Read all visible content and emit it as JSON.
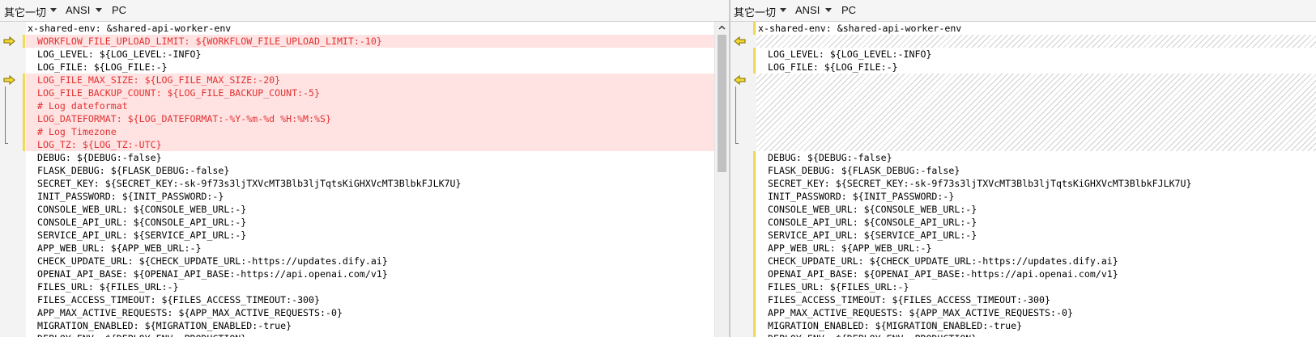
{
  "colors": {
    "changed_text": "#e23232",
    "changed_bg": "#ffe3e3",
    "change_bar": "#f1da55",
    "arrow_fill": "#f6d836"
  },
  "left": {
    "toolbar": {
      "encoding": "其它一切",
      "charset": "ANSI",
      "line_endings": "PC"
    },
    "lines": [
      {
        "text": "x-shared-env: &shared-api-worker-env",
        "state": "header"
      },
      {
        "text": "WORKFLOW_FILE_UPLOAD_LIMIT: ${WORKFLOW_FILE_UPLOAD_LIMIT:-10}",
        "state": "changed"
      },
      {
        "text": "LOG_LEVEL: ${LOG_LEVEL:-INFO}",
        "state": "normal"
      },
      {
        "text": "LOG_FILE: ${LOG_FILE:-}",
        "state": "normal"
      },
      {
        "text": "LOG_FILE_MAX_SIZE: ${LOG_FILE_MAX_SIZE:-20}",
        "state": "changed"
      },
      {
        "text": "LOG_FILE_BACKUP_COUNT: ${LOG_FILE_BACKUP_COUNT:-5}",
        "state": "changed"
      },
      {
        "text": "# Log dateformat",
        "state": "changed"
      },
      {
        "text": "LOG_DATEFORMAT: ${LOG_DATEFORMAT:-%Y-%m-%d %H:%M:%S}",
        "state": "changed"
      },
      {
        "text": "# Log Timezone",
        "state": "changed"
      },
      {
        "text": "LOG_TZ: ${LOG_TZ:-UTC}",
        "state": "changed"
      },
      {
        "text": "DEBUG: ${DEBUG:-false}",
        "state": "normal"
      },
      {
        "text": "FLASK_DEBUG: ${FLASK_DEBUG:-false}",
        "state": "normal"
      },
      {
        "text": "SECRET_KEY: ${SECRET_KEY:-sk-9f73s3ljTXVcMT3Blb3ljTqtsKiGHXVcMT3BlbkFJLK7U}",
        "state": "normal"
      },
      {
        "text": "INIT_PASSWORD: ${INIT_PASSWORD:-}",
        "state": "normal"
      },
      {
        "text": "CONSOLE_WEB_URL: ${CONSOLE_WEB_URL:-}",
        "state": "normal"
      },
      {
        "text": "CONSOLE_API_URL: ${CONSOLE_API_URL:-}",
        "state": "normal"
      },
      {
        "text": "SERVICE_API_URL: ${SERVICE_API_URL:-}",
        "state": "normal"
      },
      {
        "text": "APP_WEB_URL: ${APP_WEB_URL:-}",
        "state": "normal"
      },
      {
        "text": "CHECK_UPDATE_URL: ${CHECK_UPDATE_URL:-https://updates.dify.ai}",
        "state": "normal"
      },
      {
        "text": "OPENAI_API_BASE: ${OPENAI_API_BASE:-https://api.openai.com/v1}",
        "state": "normal"
      },
      {
        "text": "FILES_URL: ${FILES_URL:-}",
        "state": "normal"
      },
      {
        "text": "FILES_ACCESS_TIMEOUT: ${FILES_ACCESS_TIMEOUT:-300}",
        "state": "normal"
      },
      {
        "text": "APP_MAX_ACTIVE_REQUESTS: ${APP_MAX_ACTIVE_REQUESTS:-0}",
        "state": "normal"
      },
      {
        "text": "MIGRATION_ENABLED: ${MIGRATION_ENABLED:-true}",
        "state": "normal"
      },
      {
        "text": "DEPLOY_ENV: ${DEPLOY_ENV:-PRODUCTION}",
        "state": "normal"
      }
    ]
  },
  "right": {
    "toolbar": {
      "encoding": "其它一切",
      "charset": "ANSI",
      "line_endings": "PC"
    },
    "lines": [
      {
        "text": "x-shared-env: &shared-api-worker-env",
        "state": "header"
      },
      {
        "text": "",
        "state": "gap"
      },
      {
        "text": "LOG_LEVEL: ${LOG_LEVEL:-INFO}",
        "state": "normal"
      },
      {
        "text": "LOG_FILE: ${LOG_FILE:-}",
        "state": "normal"
      },
      {
        "text": "",
        "state": "gap"
      },
      {
        "text": "",
        "state": "gap"
      },
      {
        "text": "",
        "state": "gap"
      },
      {
        "text": "",
        "state": "gap"
      },
      {
        "text": "",
        "state": "gap"
      },
      {
        "text": "",
        "state": "gap"
      },
      {
        "text": "DEBUG: ${DEBUG:-false}",
        "state": "normal"
      },
      {
        "text": "FLASK_DEBUG: ${FLASK_DEBUG:-false}",
        "state": "normal"
      },
      {
        "text": "SECRET_KEY: ${SECRET_KEY:-sk-9f73s3ljTXVcMT3Blb3ljTqtsKiGHXVcMT3BlbkFJLK7U}",
        "state": "normal"
      },
      {
        "text": "INIT_PASSWORD: ${INIT_PASSWORD:-}",
        "state": "normal"
      },
      {
        "text": "CONSOLE_WEB_URL: ${CONSOLE_WEB_URL:-}",
        "state": "normal"
      },
      {
        "text": "CONSOLE_API_URL: ${CONSOLE_API_URL:-}",
        "state": "normal"
      },
      {
        "text": "SERVICE_API_URL: ${SERVICE_API_URL:-}",
        "state": "normal"
      },
      {
        "text": "APP_WEB_URL: ${APP_WEB_URL:-}",
        "state": "normal"
      },
      {
        "text": "CHECK_UPDATE_URL: ${CHECK_UPDATE_URL:-https://updates.dify.ai}",
        "state": "normal"
      },
      {
        "text": "OPENAI_API_BASE: ${OPENAI_API_BASE:-https://api.openai.com/v1}",
        "state": "normal"
      },
      {
        "text": "FILES_URL: ${FILES_URL:-}",
        "state": "normal"
      },
      {
        "text": "FILES_ACCESS_TIMEOUT: ${FILES_ACCESS_TIMEOUT:-300}",
        "state": "normal"
      },
      {
        "text": "APP_MAX_ACTIVE_REQUESTS: ${APP_MAX_ACTIVE_REQUESTS:-0}",
        "state": "normal"
      },
      {
        "text": "MIGRATION_ENABLED: ${MIGRATION_ENABLED:-true}",
        "state": "normal"
      },
      {
        "text": "DEPLOY_ENV: ${DEPLOY_ENV:-PRODUCTION}",
        "state": "normal"
      }
    ]
  }
}
